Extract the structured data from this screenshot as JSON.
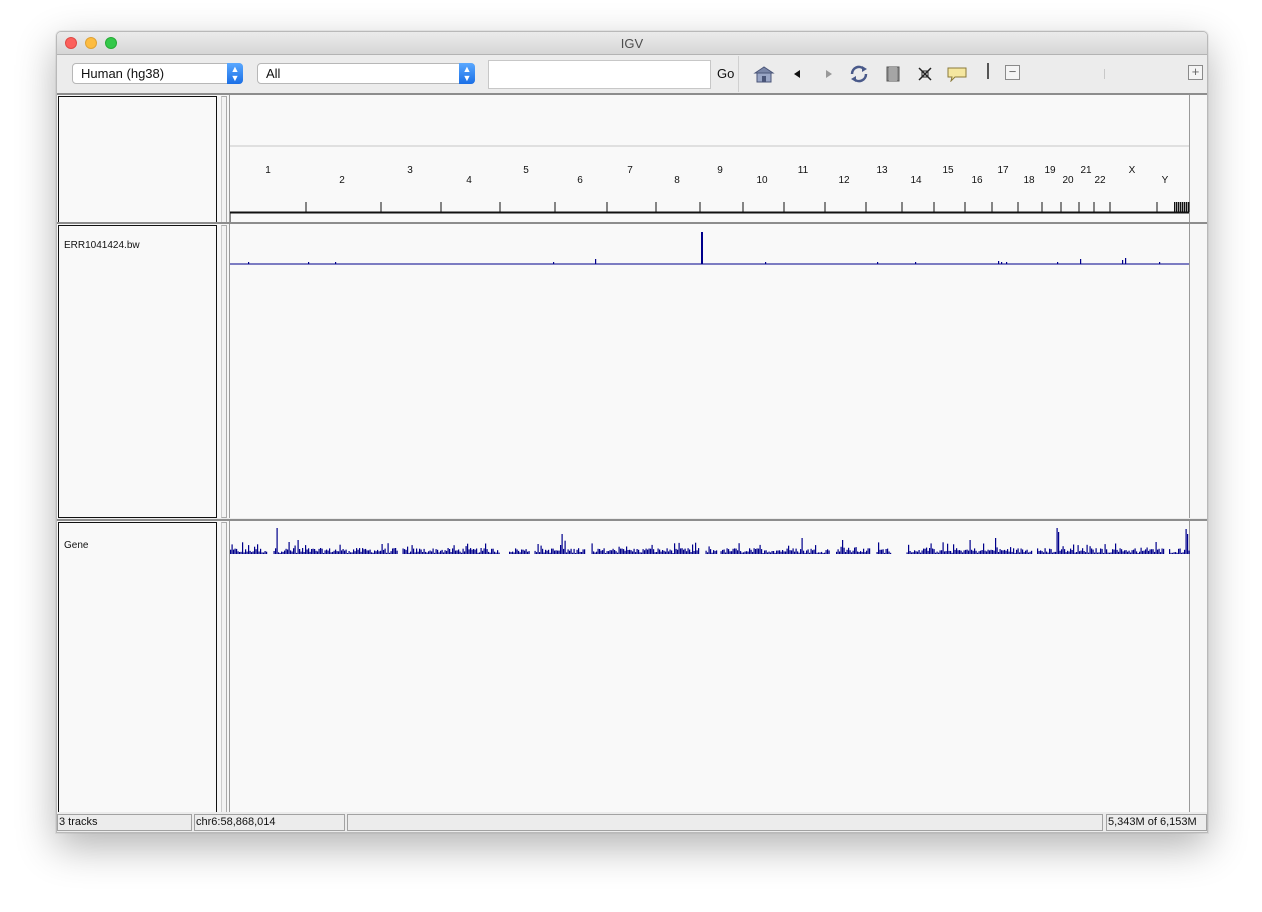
{
  "window": {
    "title": "IGV"
  },
  "toolbar": {
    "genome_select": "Human (hg38)",
    "chromosome_select": "All",
    "locus_input": "",
    "go_label": "Go",
    "icons": [
      "home-icon",
      "back-icon",
      "forward-icon",
      "refresh-icon",
      "roi-icon",
      "resize-icon",
      "popup-info-icon",
      "zoom-out-icon",
      "zoom-in-icon"
    ]
  },
  "ruler": {
    "chromosomes": [
      "1",
      "2",
      "3",
      "4",
      "5",
      "6",
      "7",
      "8",
      "9",
      "10",
      "11",
      "12",
      "13",
      "14",
      "15",
      "16",
      "17",
      "18",
      "19",
      "20",
      "21",
      "22",
      "X",
      "Y"
    ]
  },
  "tracks": [
    {
      "name": "ERR1041424.bw",
      "color": "#00008b"
    },
    {
      "name": "Gene",
      "color": "#00008b"
    }
  ],
  "status": {
    "tracks": "3 tracks",
    "position": "chr6:58,868,014",
    "message": "",
    "memory": "5,343M of 6,153M"
  }
}
